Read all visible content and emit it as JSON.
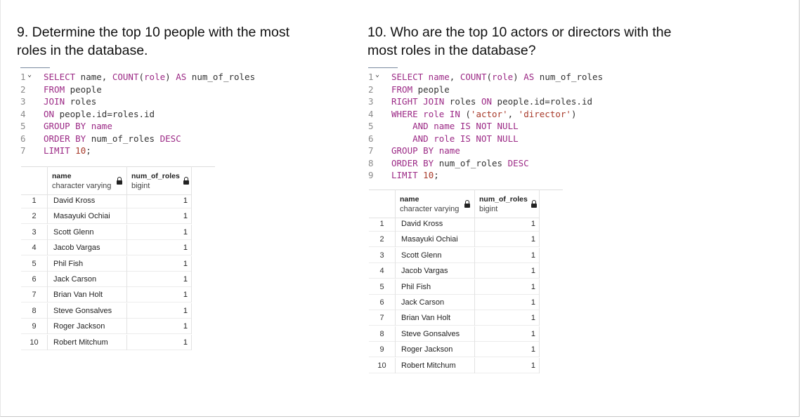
{
  "questions": {
    "q9": "9. Determine the top 10 people with the most roles in the database.",
    "q10": "10. Who are the top 10 actors or directors with the most roles in the database?"
  },
  "query1": {
    "lines": [
      {
        "n": "1",
        "tokens": [
          [
            "kw",
            "SELECT"
          ],
          [
            "id",
            " name"
          ],
          [
            "id",
            ", "
          ],
          [
            "kw",
            "COUNT"
          ],
          [
            "id",
            "("
          ],
          [
            "kw",
            "role"
          ],
          [
            "id",
            ") "
          ],
          [
            "kw",
            "AS"
          ],
          [
            "id",
            " num_of_roles"
          ]
        ]
      },
      {
        "n": "2",
        "tokens": [
          [
            "kw",
            "FROM"
          ],
          [
            "id",
            " people"
          ]
        ]
      },
      {
        "n": "3",
        "tokens": [
          [
            "kw",
            "JOIN"
          ],
          [
            "id",
            " roles"
          ]
        ]
      },
      {
        "n": "4",
        "tokens": [
          [
            "kw",
            "ON"
          ],
          [
            "id",
            " people.id=roles.id"
          ]
        ]
      },
      {
        "n": "5",
        "tokens": [
          [
            "kw",
            "GROUP BY"
          ],
          [
            "kw",
            " name"
          ]
        ]
      },
      {
        "n": "6",
        "tokens": [
          [
            "kw",
            "ORDER BY"
          ],
          [
            "id",
            " num_of_roles "
          ],
          [
            "kw",
            "DESC"
          ]
        ]
      },
      {
        "n": "7",
        "tokens": [
          [
            "kw",
            "LIMIT"
          ],
          [
            "id",
            " "
          ],
          [
            "nm",
            "10"
          ],
          [
            "id",
            ";"
          ]
        ]
      }
    ]
  },
  "query2": {
    "lines": [
      {
        "n": "1",
        "tokens": [
          [
            "kw",
            "SELECT"
          ],
          [
            "kw",
            " name"
          ],
          [
            "id",
            ", "
          ],
          [
            "kw",
            "COUNT"
          ],
          [
            "id",
            "("
          ],
          [
            "kw",
            "role"
          ],
          [
            "id",
            ") "
          ],
          [
            "kw",
            "AS"
          ],
          [
            "id",
            " num_of_roles"
          ]
        ]
      },
      {
        "n": "2",
        "tokens": [
          [
            "kw",
            "FROM"
          ],
          [
            "id",
            " people"
          ]
        ]
      },
      {
        "n": "3",
        "tokens": [
          [
            "kw",
            "RIGHT JOIN"
          ],
          [
            "id",
            " roles "
          ],
          [
            "kw",
            "ON"
          ],
          [
            "id",
            " people.id=roles.id"
          ]
        ]
      },
      {
        "n": "4",
        "tokens": [
          [
            "kw",
            "WHERE"
          ],
          [
            "kw",
            " role"
          ],
          [
            "kw",
            " IN"
          ],
          [
            "id",
            " ("
          ],
          [
            "st",
            "'actor'"
          ],
          [
            "id",
            ", "
          ],
          [
            "st",
            "'director'"
          ],
          [
            "id",
            ")"
          ]
        ]
      },
      {
        "n": "5",
        "tokens": [
          [
            "id",
            "    "
          ],
          [
            "kw",
            "AND"
          ],
          [
            "kw",
            " name"
          ],
          [
            "kw",
            " IS NOT NULL"
          ]
        ]
      },
      {
        "n": "6",
        "tokens": [
          [
            "id",
            "    "
          ],
          [
            "kw",
            "AND"
          ],
          [
            "kw",
            " role"
          ],
          [
            "kw",
            " IS NOT NULL"
          ]
        ]
      },
      {
        "n": "7",
        "tokens": [
          [
            "kw",
            "GROUP BY"
          ],
          [
            "kw",
            " name"
          ]
        ]
      },
      {
        "n": "8",
        "tokens": [
          [
            "kw",
            "ORDER BY"
          ],
          [
            "id",
            " num_of_roles "
          ],
          [
            "kw",
            "DESC"
          ]
        ]
      },
      {
        "n": "9",
        "tokens": [
          [
            "kw",
            "LIMIT"
          ],
          [
            "id",
            " "
          ],
          [
            "nm",
            "10"
          ],
          [
            "id",
            ";"
          ]
        ]
      }
    ]
  },
  "results": {
    "columns": [
      {
        "name": "name",
        "type": "character varying"
      },
      {
        "name": "num_of_roles",
        "type": "bigint"
      }
    ],
    "rows": [
      {
        "n": "1",
        "name": "David Kross",
        "val": "1"
      },
      {
        "n": "2",
        "name": "Masayuki Ochiai",
        "val": "1"
      },
      {
        "n": "3",
        "name": "Scott Glenn",
        "val": "1"
      },
      {
        "n": "4",
        "name": "Jacob Vargas",
        "val": "1"
      },
      {
        "n": "5",
        "name": "Phil Fish",
        "val": "1"
      },
      {
        "n": "6",
        "name": "Jack Carson",
        "val": "1"
      },
      {
        "n": "7",
        "name": "Brian Van Holt",
        "val": "1"
      },
      {
        "n": "8",
        "name": "Steve Gonsalves",
        "val": "1"
      },
      {
        "n": "9",
        "name": "Roger Jackson",
        "val": "1"
      },
      {
        "n": "10",
        "name": "Robert Mitchum",
        "val": "1"
      }
    ]
  },
  "colors": {
    "keyword": "#9c2a86",
    "string": "#a83a2a",
    "line_number": "#8a8a8a"
  }
}
